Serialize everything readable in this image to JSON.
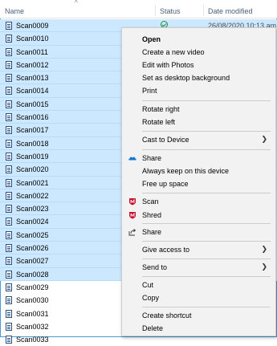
{
  "columns": {
    "name": "Name",
    "status": "Status",
    "date_modified": "Date modified"
  },
  "files": [
    {
      "name": "Scan0009",
      "selected": true,
      "date": "26/08/2020 10:13 am",
      "status": "synced"
    },
    {
      "name": "Scan0010",
      "selected": true
    },
    {
      "name": "Scan0011",
      "selected": true
    },
    {
      "name": "Scan0012",
      "selected": true
    },
    {
      "name": "Scan0013",
      "selected": true
    },
    {
      "name": "Scan0014",
      "selected": true
    },
    {
      "name": "Scan0015",
      "selected": true
    },
    {
      "name": "Scan0016",
      "selected": true
    },
    {
      "name": "Scan0017",
      "selected": true
    },
    {
      "name": "Scan0018",
      "selected": true
    },
    {
      "name": "Scan0019",
      "selected": true
    },
    {
      "name": "Scan0020",
      "selected": true
    },
    {
      "name": "Scan0021",
      "selected": true
    },
    {
      "name": "Scan0022",
      "selected": true
    },
    {
      "name": "Scan0023",
      "selected": true
    },
    {
      "name": "Scan0024",
      "selected": true
    },
    {
      "name": "Scan0025",
      "selected": true
    },
    {
      "name": "Scan0026",
      "selected": true
    },
    {
      "name": "Scan0027",
      "selected": true
    },
    {
      "name": "Scan0028",
      "selected": true
    },
    {
      "name": "Scan0029",
      "selected": false
    },
    {
      "name": "Scan0030",
      "selected": false
    },
    {
      "name": "Scan0031",
      "selected": false
    },
    {
      "name": "Scan0032",
      "selected": false
    },
    {
      "name": "Scan0033",
      "selected": false
    }
  ],
  "context_menu": {
    "open": "Open",
    "create_video": "Create a new video",
    "edit_photos": "Edit with Photos",
    "set_background": "Set as desktop background",
    "print": "Print",
    "rotate_right": "Rotate right",
    "rotate_left": "Rotate left",
    "cast": "Cast to Device",
    "share_onedrive": "Share",
    "always_keep": "Always keep on this device",
    "free_space": "Free up space",
    "scan": "Scan",
    "shred": "Shred",
    "share": "Share",
    "give_access": "Give access to",
    "send_to": "Send to",
    "cut": "Cut",
    "copy": "Copy",
    "create_shortcut": "Create shortcut",
    "delete": "Delete"
  },
  "colors": {
    "selection": "#cce8ff",
    "onedrive": "#0f78d4",
    "mcafee": "#c8102e",
    "status_ok": "#1e8c3a"
  }
}
